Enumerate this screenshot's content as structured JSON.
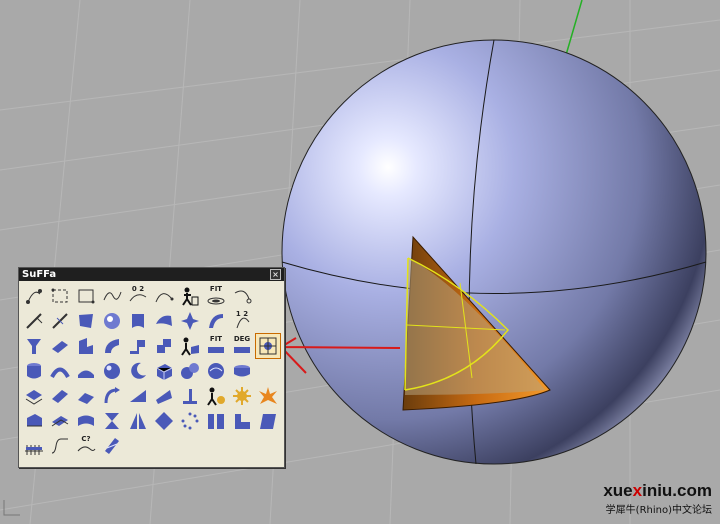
{
  "toolbar": {
    "title": "SuFFa",
    "close_glyph": "×",
    "buttons": [
      {
        "icon": "curve-points-icon"
      },
      {
        "icon": "rect-corners-icon"
      },
      {
        "icon": "rect-edges-icon"
      },
      {
        "icon": "curve-wave-icon"
      },
      {
        "icon": "curve-02-icon",
        "label": "0 2"
      },
      {
        "icon": "curve-arc-icon"
      },
      {
        "icon": "worker-icon"
      },
      {
        "icon": "fit-curve-icon",
        "label": "FIT"
      },
      {
        "icon": "curve-end-icon"
      },
      {
        "icon": "blank"
      },
      {
        "icon": "knife-icon"
      },
      {
        "icon": "blade-icon"
      },
      {
        "icon": "flag-surface-icon"
      },
      {
        "icon": "sphere-dot-icon"
      },
      {
        "icon": "pipe-surface-icon"
      },
      {
        "icon": "twist-surface-icon"
      },
      {
        "icon": "star-points-icon"
      },
      {
        "icon": "patch-surface-icon"
      },
      {
        "icon": "num-12-icon",
        "label": "1 2"
      },
      {
        "icon": "blank"
      },
      {
        "icon": "funnel-icon"
      },
      {
        "icon": "plane-surface-icon"
      },
      {
        "icon": "fold-surface-icon"
      },
      {
        "icon": "bend-surface-icon"
      },
      {
        "icon": "split-surface-icon"
      },
      {
        "icon": "step-surface-icon"
      },
      {
        "icon": "worker-surface-icon"
      },
      {
        "icon": "fit-surface-icon",
        "label": "FIT"
      },
      {
        "icon": "deg-surface-icon",
        "label": "DEG"
      },
      {
        "icon": "select-box-icon",
        "highlight": true
      },
      {
        "icon": "cylinder-icon"
      },
      {
        "icon": "loft-arch-icon"
      },
      {
        "icon": "arch-flat-icon"
      },
      {
        "icon": "sphere-icon"
      },
      {
        "icon": "moon-icon"
      },
      {
        "icon": "cube-icon"
      },
      {
        "icon": "spheres-icon"
      },
      {
        "icon": "blob-icon"
      },
      {
        "icon": "cylinder-short-icon"
      },
      {
        "icon": "blank"
      },
      {
        "icon": "slab-icon"
      },
      {
        "icon": "sheet-icon"
      },
      {
        "icon": "slide-icon"
      },
      {
        "icon": "arrow-curve-icon"
      },
      {
        "icon": "wedge-icon"
      },
      {
        "icon": "plane-tilt-icon"
      },
      {
        "icon": "t-stand-icon"
      },
      {
        "icon": "worker-gear-icon"
      },
      {
        "icon": "gear-icon"
      },
      {
        "icon": "burst-icon"
      },
      {
        "icon": "extrude-icon"
      },
      {
        "icon": "offset-icon"
      },
      {
        "icon": "drape-icon"
      },
      {
        "icon": "hourglass-icon"
      },
      {
        "icon": "mirror-icon"
      },
      {
        "icon": "diamond-icon"
      },
      {
        "icon": "dots-ring-icon"
      },
      {
        "icon": "panel-split-icon"
      },
      {
        "icon": "corner-icon"
      },
      {
        "icon": "block-icon"
      },
      {
        "icon": "grid-plane-icon"
      },
      {
        "icon": "zigzag-icon"
      },
      {
        "icon": "continuity-check-icon",
        "label": "C?"
      },
      {
        "icon": "stack-icon"
      }
    ]
  },
  "watermark": {
    "site_prefix": "xue",
    "site_x": "x",
    "site_suffix": "iniu.com",
    "forum": "学犀牛(Rhino)中文论坛"
  },
  "scene": {
    "sphere_color": "#a7aee0",
    "patch_color": "#e8861e",
    "edge_color": "#e3e31a",
    "arrow_color": "#d81a1a",
    "background_color": "#a9a9a9",
    "grid_color": "#b8b8b8"
  }
}
